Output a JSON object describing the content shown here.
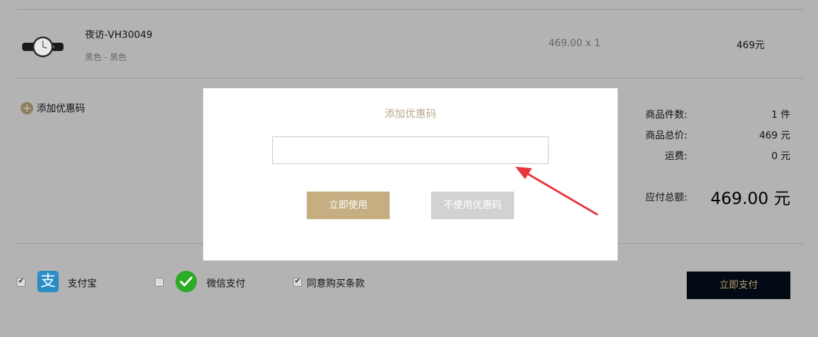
{
  "product": {
    "name": "夜访-VH30049",
    "spec": "黑色 - 黑色",
    "price_qty": "469.00 x 1",
    "line_total": "469元"
  },
  "coupon": {
    "add_label": "添加优惠码"
  },
  "summary": {
    "items_label": "商品件数:",
    "items_value": "1 件",
    "subtotal_label": "商品总价:",
    "subtotal_value": "469 元",
    "shipping_label": "运费:",
    "shipping_value": "0 元",
    "total_label": "应付总额:",
    "total_value": "469.00 元"
  },
  "payment": {
    "alipay_label": "支付宝",
    "alipay_checked": true,
    "wechat_label": "微信支付",
    "wechat_checked": false,
    "agree_label": "同意购买条款",
    "agree_checked": true,
    "pay_button": "立即支付"
  },
  "modal": {
    "title": "添加优惠码",
    "input_value": "",
    "use_button": "立即使用",
    "no_use_button": "不使用优惠码"
  },
  "colors": {
    "gold": "#c4ae82",
    "dark": "#020b15",
    "annotation_arrow": "#e8353c"
  }
}
